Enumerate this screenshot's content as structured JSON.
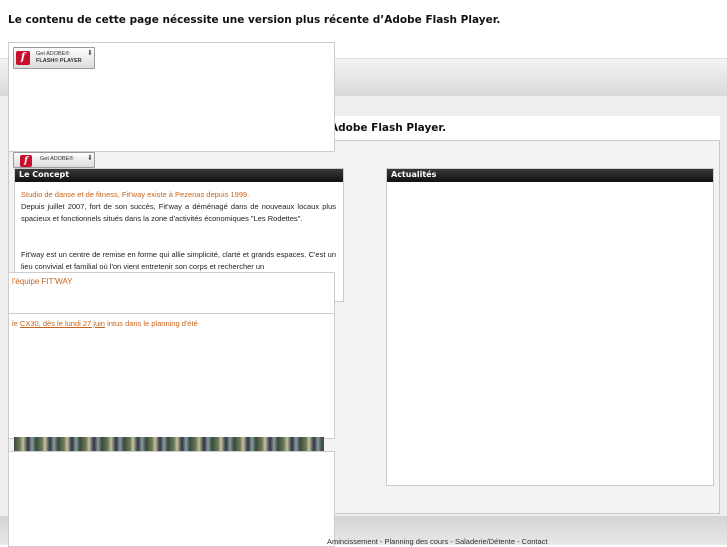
{
  "flash_message": "Le contenu de cette page nécessite une version plus récente d’Adobe Flash Player.",
  "flash_message_partial": "Adobe Flash Player.",
  "badge_top": {
    "line1": "Get ADOBE®",
    "line2": "FLASH® PLAYER"
  },
  "badge_second": {
    "line1": "Get ADOBE®"
  },
  "concept": {
    "heading": "Le Concept",
    "p1": "Studio de danse et de fitness, Fit'way existe à Pezenas depuis 1999.",
    "p2": "Depuis juillet 2007, fort de son succès, Fit'way a déménagé dans de nouveaux locaux plus spacieux et fonctionnels situés dans la zone d'activités économiques \"Les Rodettes\".",
    "p3": "Fit'way est un centre de remise en forme qui allie simplicité, clarté et grands espaces. C'est un lieu convivial et familial où l'on vient entretenir son corps et rechercher un"
  },
  "equipe": {
    "text": "l'équipe FIT'WAY"
  },
  "news": {
    "prefix": "le ",
    "link": "CX30, dès le lundi 27 juin",
    "suffix": " intus dans le planning d'été"
  },
  "actualites": {
    "heading": "Actualités"
  },
  "footer": {
    "text": "Amincissement - Planning des cours - Saladerie/Détente - Contact"
  },
  "colors": {
    "accent": "#c8641a",
    "dark_bar": "#1a1a1a",
    "flash_red": "#c8102e"
  }
}
